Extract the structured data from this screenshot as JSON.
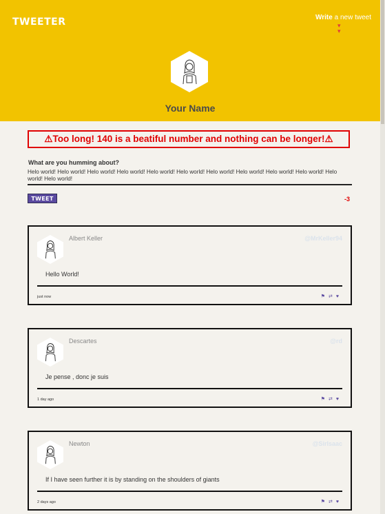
{
  "header": {
    "logo": "TWEETER",
    "write_link_bold": "Write",
    "write_link_rest": " a new tweet",
    "profile_name": "Your Name"
  },
  "compose": {
    "error": "⚠Too long! 140 is a beatiful number and nothing can be longer!⚠",
    "prompt": "What are you humming about?",
    "text": "Helo world! Helo world! Helo world! Helo world! Helo world! Helo world! Helo world! Helo world! Helo world! Helo world! Helo world! Helo world!",
    "tweet_button": "TWEET",
    "counter": "-3"
  },
  "tweets": [
    {
      "name": "Albert Keller",
      "handle": "@MrKeller94",
      "text": "Hello World!",
      "time": "just now"
    },
    {
      "name": "Descartes",
      "handle": "@rd",
      "text": "Je pense , donc je suis",
      "time": "1 day ago"
    },
    {
      "name": "Newton",
      "handle": "@SirIsaac",
      "text": "If I have seen further it is by standing on the shoulders of giants",
      "time": "2 days ago"
    }
  ],
  "icons": {
    "flag": "flag-icon",
    "retweet": "retweet-icon",
    "like": "heart-icon"
  },
  "colors": {
    "header_bg": "#f2c300",
    "accent": "#5b4aa0",
    "error": "#e00000",
    "page_bg": "#f4f2ed"
  }
}
